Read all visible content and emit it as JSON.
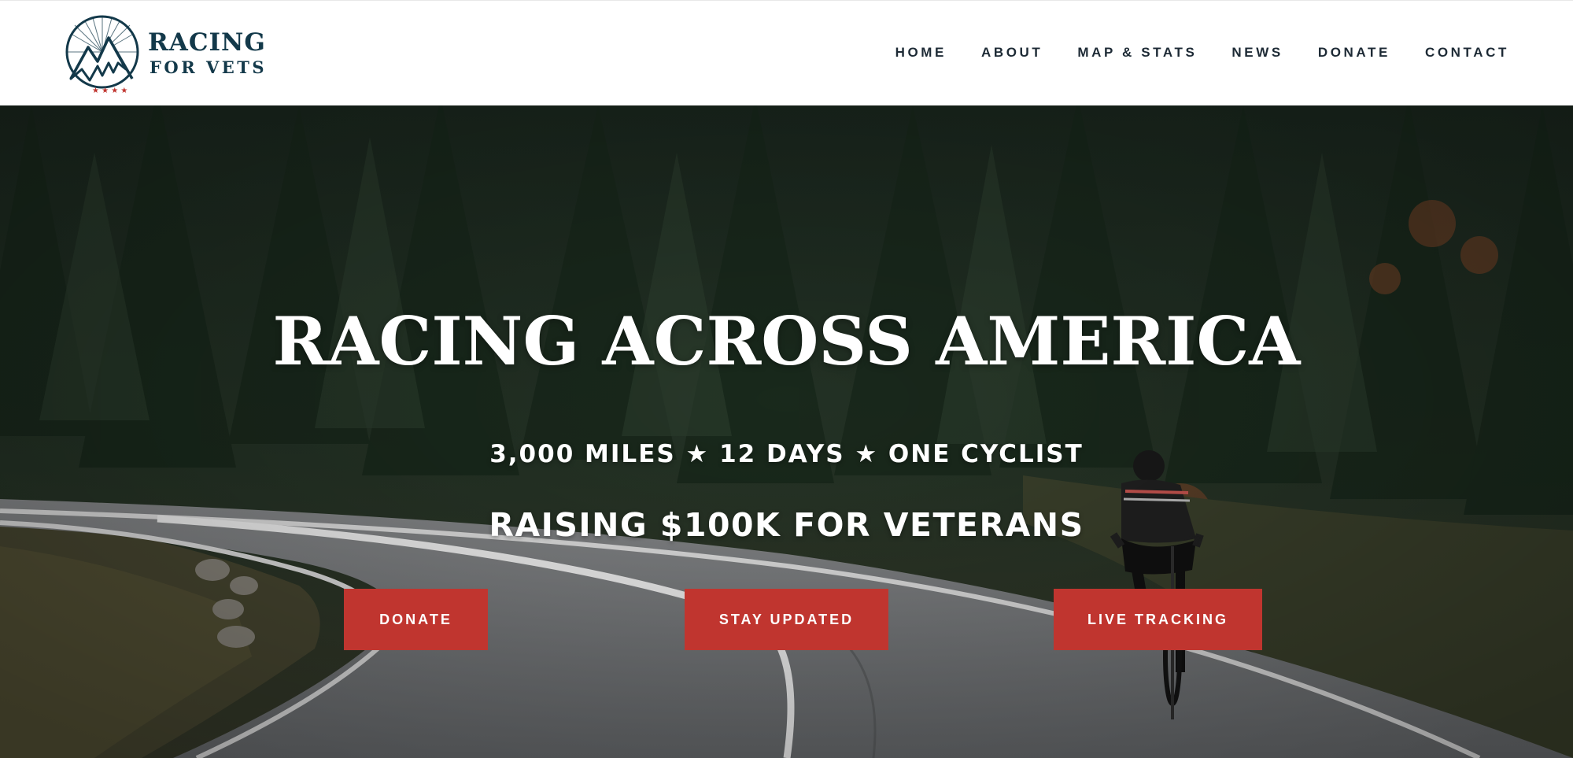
{
  "brand": {
    "name_line1": "RACING",
    "name_line2": "FOR VETS",
    "colors": {
      "navy": "#13394a",
      "accent": "#c0352f"
    }
  },
  "nav": {
    "items": [
      {
        "label": "HOME"
      },
      {
        "label": "ABOUT"
      },
      {
        "label": "MAP & STATS"
      },
      {
        "label": "NEWS"
      },
      {
        "label": "DONATE"
      },
      {
        "label": "CONTACT"
      }
    ]
  },
  "hero": {
    "title": "RACING ACROSS AMERICA",
    "subtitle": "3,000 MILES ★ 12 DAYS ★ ONE CYCLIST",
    "tagline": "RAISING $100K FOR VETERANS",
    "buttons": {
      "donate": "DONATE",
      "stay_updated": "STAY UPDATED",
      "live_tracking": "LIVE TRACKING"
    },
    "background": "forest-road-cyclist-photo"
  }
}
